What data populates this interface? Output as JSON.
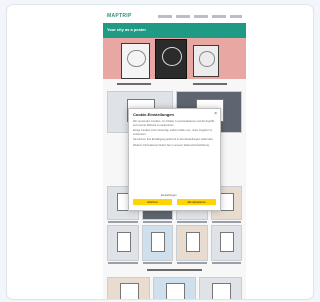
{
  "site": {
    "logo": "MAPTRIP",
    "hero_headline": "Your city as a poster"
  },
  "consent_dialog": {
    "title": "Cookie-Einstellungen",
    "close_glyph": "×",
    "paragraphs": [
      "Wir verwenden Cookies, um Inhalte zu personalisieren und die Zugriffe auf unserer Website zu analysieren.",
      "Einige Cookies sind notwendig, andere helfen uns, unser Angebot zu verbessern.",
      "Sie können Ihre Einwilligung jederzeit in den Einstellungen widerrufen.",
      "Weitere Informationen finden Sie in unserer Datenschutzerklärung."
    ],
    "settings_link": "Einstellungen",
    "deny_label": "Ablehnen",
    "accept_label": "Alle akzeptieren"
  },
  "colors": {
    "brand": "#1f9b85",
    "accent": "#ffd400",
    "hero_bg": "#e9a7a3"
  }
}
